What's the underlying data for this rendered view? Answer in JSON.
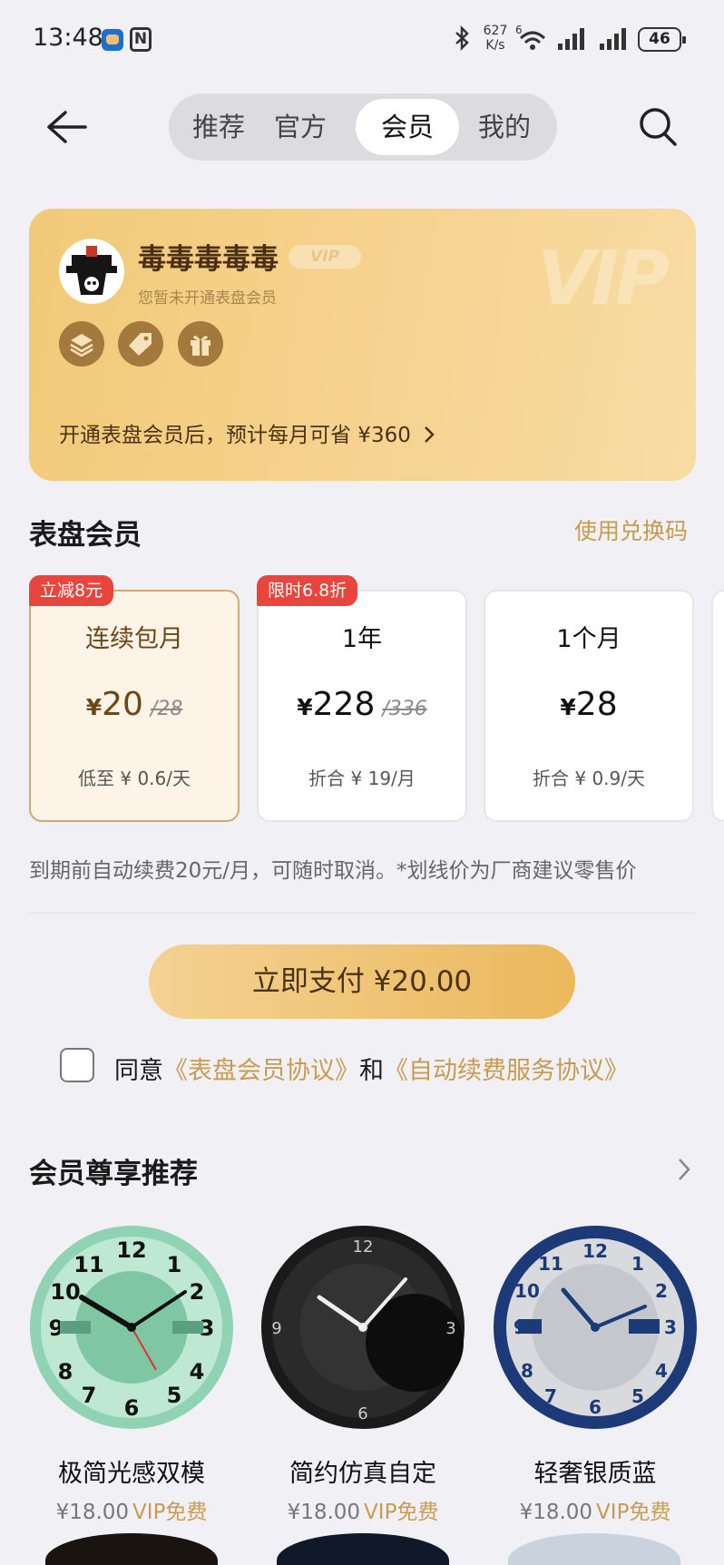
{
  "status_bar": {
    "time": "13:48",
    "net_speed_top": "627",
    "net_speed_bottom": "K/s",
    "nfc_label": "N",
    "wifi_tag": "6",
    "battery": "46"
  },
  "nav": {
    "tabs": [
      {
        "label": "推荐"
      },
      {
        "label": "官方"
      },
      {
        "label": "会员"
      },
      {
        "label": "我的"
      }
    ],
    "active_tab": "会员"
  },
  "vip_card": {
    "username": "毒毒毒毒毒",
    "vip_tag": "VIP",
    "watermark": "VIP",
    "status": "您暂未开通表盘会员",
    "savings_text": "开通表盘会员后，预计每月可省 ¥360",
    "perk_icons": [
      "layers-icon",
      "tag-icon",
      "gift-icon"
    ]
  },
  "membership": {
    "title": "表盘会员",
    "redeem_link": "使用兑换码",
    "plans": [
      {
        "badge": "立减8元",
        "name": "连续包月",
        "currency": "¥",
        "price": "20",
        "original": "/28",
        "daily": "低至 ¥ 0.6/天"
      },
      {
        "badge": "限时6.8折",
        "name": "1年",
        "currency": "¥",
        "price": "228",
        "original": "/336",
        "daily": "折合 ¥ 19/月"
      },
      {
        "badge": "",
        "name": "1个月",
        "currency": "¥",
        "price": "28",
        "original": "",
        "daily": "折合 ¥ 0.9/天"
      }
    ],
    "selected_plan": "连续包月",
    "renew_note": "到期前自动续费20元/月，可随时取消。*划线价为厂商建议零售价",
    "pay_button": "立即支付 ¥20.00",
    "agreement": {
      "prefix": "同意",
      "link1": "《表盘会员协议》",
      "middle": "和",
      "link2": "《自动续费服务协议》"
    }
  },
  "recommend": {
    "title": "会员尊享推荐",
    "faces": [
      {
        "name": "极简光感双模",
        "price": "¥18.00",
        "vip": "VIP免费"
      },
      {
        "name": "简约仿真自定",
        "price": "¥18.00",
        "vip": "VIP免费"
      },
      {
        "name": "轻奢银质蓝",
        "price": "¥18.00",
        "vip": "VIP免费"
      }
    ]
  },
  "colors": {
    "accent_gold": "#c79c52",
    "badge_red": "#e8453c",
    "card_gold": "#f1ca78",
    "background": "#f1f1f5"
  }
}
